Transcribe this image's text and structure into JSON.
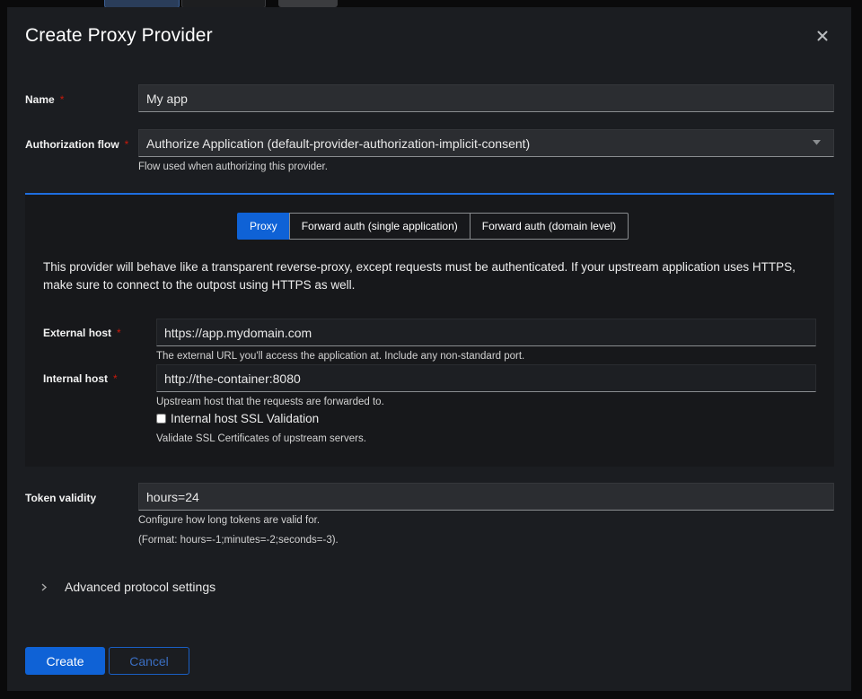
{
  "modal": {
    "title": "Create Proxy Provider",
    "close_label": "×"
  },
  "name_field": {
    "label": "Name",
    "required_mark": "*",
    "value": "My app"
  },
  "auth_flow": {
    "label": "Authorization flow",
    "required_mark": "*",
    "selected": "Authorize Application (default-provider-authorization-implicit-consent)",
    "helper": "Flow used when authorizing this provider."
  },
  "mode_tabs": [
    {
      "label": "Proxy",
      "active": true
    },
    {
      "label": "Forward auth (single application)",
      "active": false
    },
    {
      "label": "Forward auth (domain level)",
      "active": false
    }
  ],
  "proxy_description": "This provider will behave like a transparent reverse-proxy, except requests must be authenticated. If your upstream application uses HTTPS, make sure to connect to the outpost using HTTPS as well.",
  "external_host": {
    "label": "External host",
    "required_mark": "*",
    "value": "https://app.mydomain.com",
    "helper": "The external URL you'll access the application at. Include any non-standard port."
  },
  "internal_host": {
    "label": "Internal host",
    "required_mark": "*",
    "value": "http://the-container:8080",
    "helper": "Upstream host that the requests are forwarded to."
  },
  "ssl_validation": {
    "label": "Internal host SSL Validation",
    "checked": false,
    "helper": "Validate SSL Certificates of upstream servers."
  },
  "token_validity": {
    "label": "Token validity",
    "value": "hours=24",
    "helper_line1": "Configure how long tokens are valid for.",
    "helper_line2": "(Format: hours=-1;minutes=-2;seconds=-3)."
  },
  "advanced": {
    "label": "Advanced protocol settings"
  },
  "footer": {
    "create_label": "Create",
    "cancel_label": "Cancel"
  },
  "colors": {
    "accent": "#0f62d6",
    "panel_border": "#1e6ee0",
    "required": "#c9190b"
  }
}
